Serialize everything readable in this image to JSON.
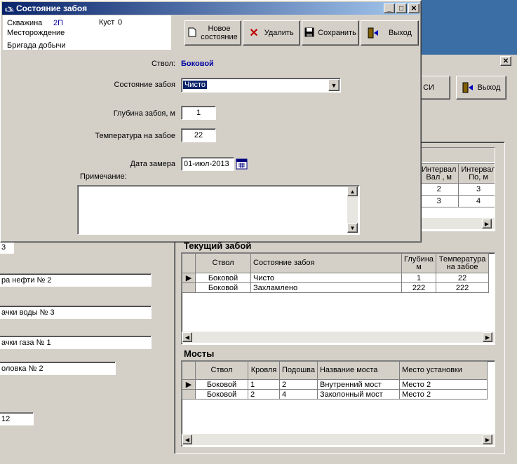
{
  "back_window": {
    "exit_label": "Выход",
    "partial_button_label": "СИ",
    "fields": [
      "3",
      "ра нефти № 2",
      "ачки воды № 3",
      "ачки газа № 1",
      "оловка № 2",
      "12"
    ],
    "top_grid": {
      "headers": [
        [
          "Интервал",
          "Вал , м"
        ],
        [
          "Интервал",
          "По, м"
        ],
        [
          "",
          ""
        ]
      ],
      "rows": [
        [
          "2",
          "3"
        ],
        [
          "3",
          "4"
        ]
      ]
    },
    "current_zaboi": {
      "title": "Текущий забой",
      "headers": [
        "Ствол",
        "Состояние забоя",
        "Глубина м",
        "Температура на забое"
      ],
      "rows": [
        {
          "stvol": "Боковой",
          "state": "Чисто",
          "depth": "1",
          "temp": "22"
        },
        {
          "stvol": "Боковой",
          "state": "Захламлено",
          "depth": "222",
          "temp": "222"
        }
      ]
    },
    "mosty": {
      "title": "Мосты",
      "headers": [
        "Ствол",
        "Кровля",
        "Подошва",
        "Название моста",
        "Место установки"
      ],
      "rows": [
        {
          "stvol": "Боковой",
          "roof": "1",
          "sole": "2",
          "name": "Внутренний мост",
          "place": "Место 2"
        },
        {
          "stvol": "Боковой",
          "roof": "2",
          "sole": "4",
          "name": "Заколонный мост",
          "place": "Место 2"
        }
      ]
    }
  },
  "dialog": {
    "title": "Состояние забоя",
    "info": {
      "well_label": "Скважина",
      "well_value": "2П",
      "bush_label": "Куст",
      "bush_value": "0",
      "field_label": "Месторождение",
      "brigade_label": "Бригада добычи"
    },
    "toolbar": {
      "new_label_1": "Новое",
      "new_label_2": "состояние",
      "delete_label": "Удалить",
      "save_label": "Сохранить",
      "exit_label": "Выход"
    },
    "form": {
      "stvol_label": "Ствол:",
      "stvol_value": "Боковой",
      "state_label": "Состояние забоя",
      "state_value": "Чисто",
      "depth_label": "Глубина забоя, м",
      "depth_value": "1",
      "temp_label": "Температура на забое",
      "temp_value": "22",
      "date_label": "Дата замера",
      "date_value": "01-июл-2013",
      "note_label": "Примечание:",
      "note_value": ""
    },
    "colors": {
      "titlebar": "#0a246a",
      "accent_text": "#0000a0"
    }
  }
}
